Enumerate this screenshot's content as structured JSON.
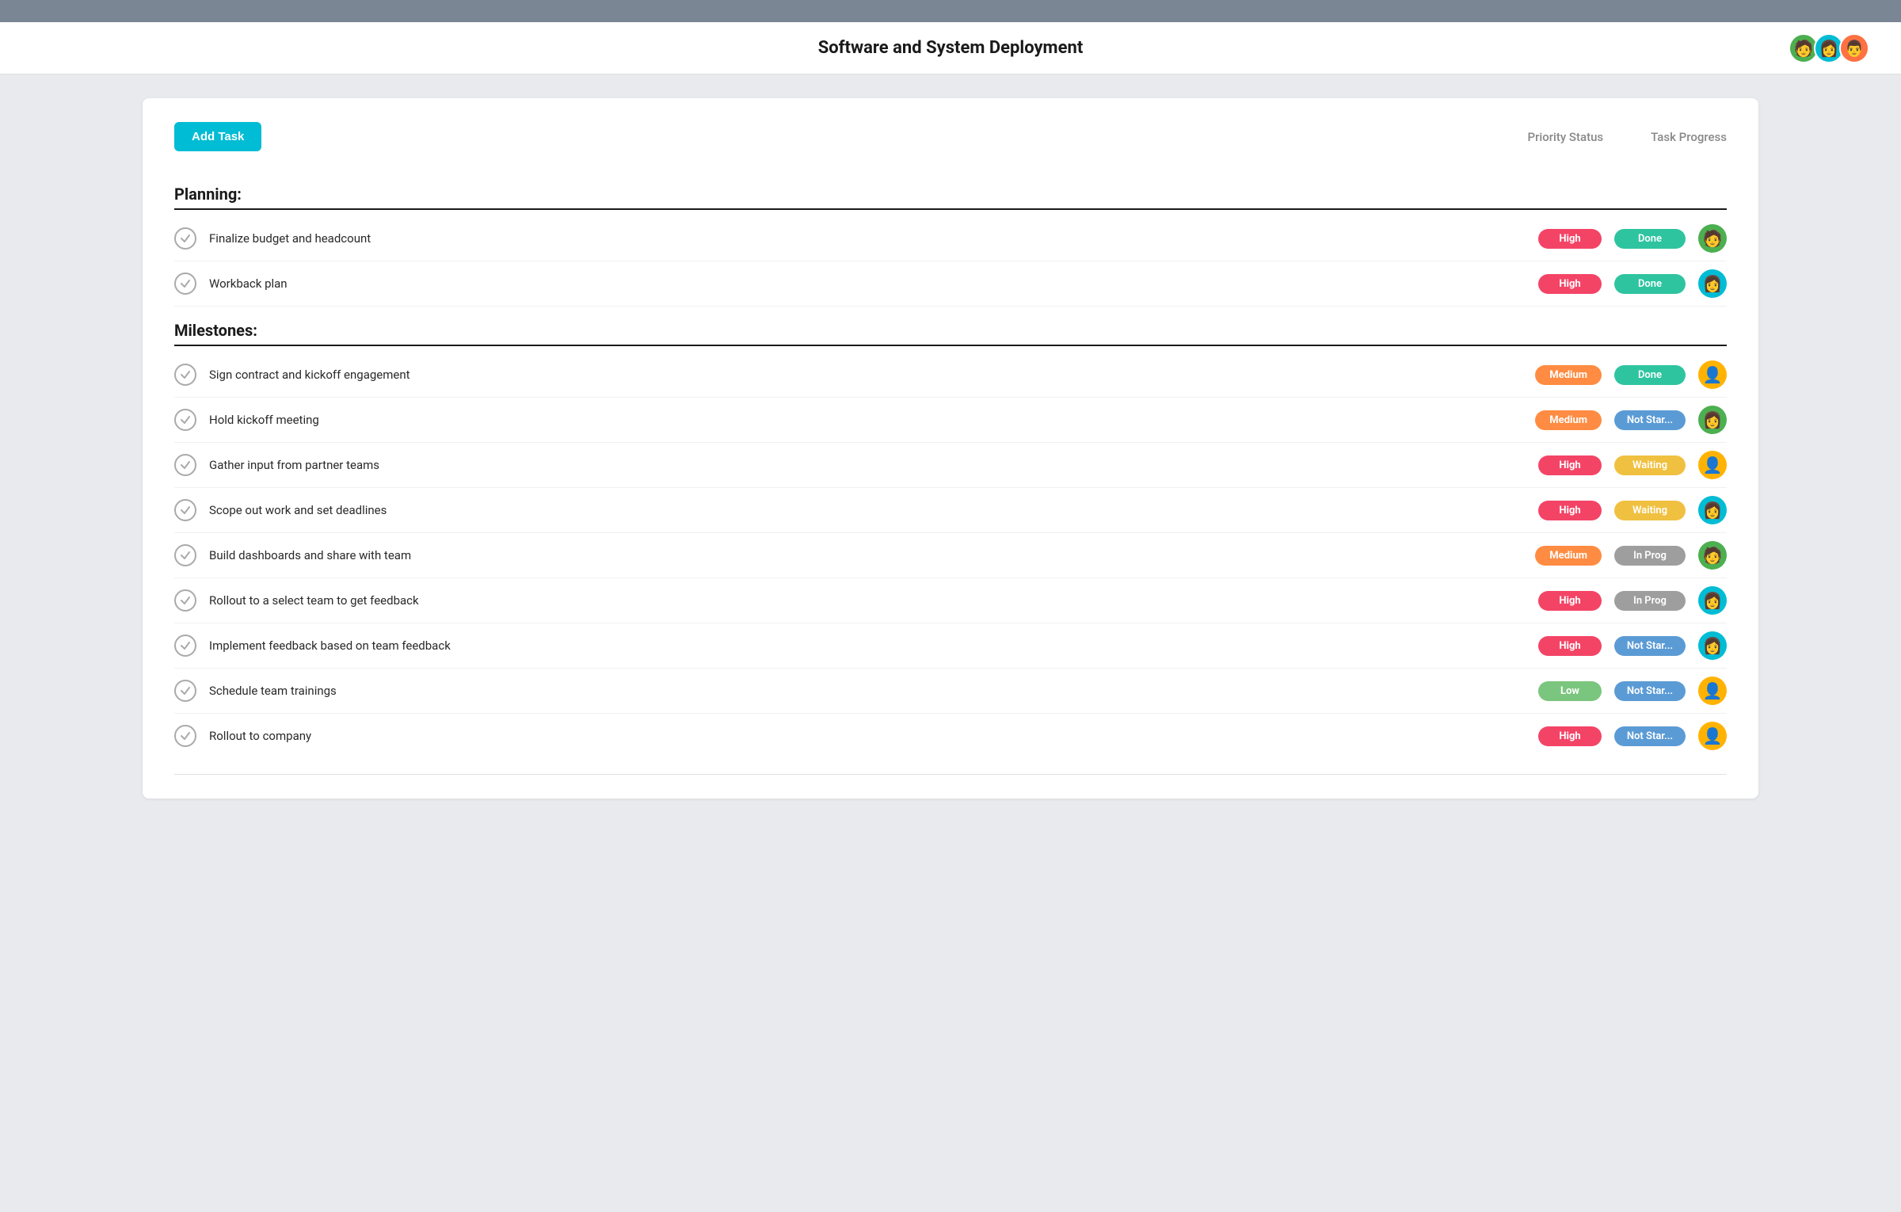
{
  "topbar": {},
  "header": {
    "title": "Software and System Deployment",
    "avatars": [
      {
        "emoji": "🧑",
        "bg": "#4caf50",
        "label": "avatar-1"
      },
      {
        "emoji": "👩",
        "bg": "#00bcd4",
        "label": "avatar-2"
      },
      {
        "emoji": "👨",
        "bg": "#ff7043",
        "label": "avatar-3"
      }
    ]
  },
  "toolbar": {
    "add_task_label": "Add Task",
    "col1_label": "Priority Status",
    "col2_label": "Task Progress"
  },
  "sections": [
    {
      "title": "Planning:",
      "tasks": [
        {
          "name": "Finalize budget and headcount",
          "priority": "High",
          "priority_class": "priority-high",
          "status": "Done",
          "status_class": "status-done",
          "avatar_emoji": "🧑",
          "avatar_bg": "#4caf50"
        },
        {
          "name": "Workback plan",
          "priority": "High",
          "priority_class": "priority-high",
          "status": "Done",
          "status_class": "status-done",
          "avatar_emoji": "👩",
          "avatar_bg": "#00bcd4"
        }
      ]
    },
    {
      "title": "Milestones:",
      "tasks": [
        {
          "name": "Sign contract and kickoff engagement",
          "priority": "Medium",
          "priority_class": "priority-medium",
          "status": "Done",
          "status_class": "status-done",
          "avatar_emoji": "👤",
          "avatar_bg": "#ffb300"
        },
        {
          "name": "Hold kickoff meeting",
          "priority": "Medium",
          "priority_class": "priority-medium",
          "status": "Not Star...",
          "status_class": "status-not-started",
          "avatar_emoji": "👩",
          "avatar_bg": "#4caf50"
        },
        {
          "name": "Gather input from partner teams",
          "priority": "High",
          "priority_class": "priority-high",
          "status": "Waiting",
          "status_class": "status-waiting",
          "avatar_emoji": "👤",
          "avatar_bg": "#ffb300"
        },
        {
          "name": "Scope out work and set deadlines",
          "priority": "High",
          "priority_class": "priority-high",
          "status": "Waiting",
          "status_class": "status-waiting",
          "avatar_emoji": "👩",
          "avatar_bg": "#00bcd4"
        },
        {
          "name": "Build dashboards and share with team",
          "priority": "Medium",
          "priority_class": "priority-medium",
          "status": "In Prog",
          "status_class": "status-in-progress",
          "avatar_emoji": "🧑",
          "avatar_bg": "#4caf50"
        },
        {
          "name": "Rollout to a select team to get feedback",
          "priority": "High",
          "priority_class": "priority-high",
          "status": "In Prog",
          "status_class": "status-in-progress",
          "avatar_emoji": "👩",
          "avatar_bg": "#00bcd4"
        },
        {
          "name": "Implement feedback based on team feedback",
          "priority": "High",
          "priority_class": "priority-high",
          "status": "Not Star...",
          "status_class": "status-not-started",
          "avatar_emoji": "👩",
          "avatar_bg": "#00bcd4"
        },
        {
          "name": "Schedule team trainings",
          "priority": "Low",
          "priority_class": "priority-low",
          "status": "Not Star...",
          "status_class": "status-not-started",
          "avatar_emoji": "👤",
          "avatar_bg": "#ffb300"
        },
        {
          "name": "Rollout to company",
          "priority": "High",
          "priority_class": "priority-high",
          "status": "Not Star...",
          "status_class": "status-not-started",
          "avatar_emoji": "👤",
          "avatar_bg": "#ffb300"
        }
      ]
    }
  ]
}
